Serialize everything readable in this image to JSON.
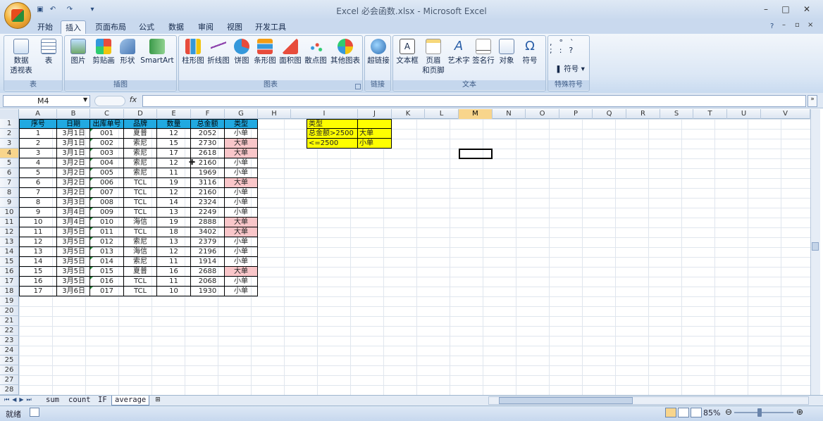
{
  "window": {
    "title": "Excel 必会函数.xlsx - Microsoft Excel"
  },
  "tabs": [
    "开始",
    "插入",
    "页面布局",
    "公式",
    "数据",
    "审阅",
    "视图",
    "开发工具"
  ],
  "active_tab": "插入",
  "ribbon": {
    "groups": [
      {
        "label": "表",
        "buttons": [
          "数据\n透视表",
          "表"
        ]
      },
      {
        "label": "插图",
        "buttons": [
          "图片",
          "剪贴画",
          "形状",
          "SmartArt"
        ]
      },
      {
        "label": "图表",
        "buttons": [
          "柱形图",
          "折线图",
          "饼图",
          "条形图",
          "面积图",
          "散点图",
          "其他图表"
        ]
      },
      {
        "label": "链接",
        "buttons": [
          "超链接"
        ]
      },
      {
        "label": "文本",
        "buttons": [
          "文本框",
          "页眉\n和页脚",
          "艺术字",
          "签名行",
          "对象",
          "符号"
        ]
      },
      {
        "label": "特殊符号",
        "buttons": [
          "符号"
        ]
      }
    ]
  },
  "formula_bar": {
    "name_box": "M4",
    "fx": "fx",
    "formula": ""
  },
  "columns": [
    "A",
    "B",
    "C",
    "D",
    "E",
    "F",
    "G",
    "H",
    "I",
    "J",
    "K",
    "L",
    "M",
    "N",
    "O",
    "P",
    "Q",
    "R",
    "S",
    "T",
    "U",
    "V"
  ],
  "selected_column": "M",
  "rows": [
    "1",
    "2",
    "3",
    "4",
    "5",
    "6",
    "7",
    "8",
    "9",
    "10",
    "11",
    "12",
    "13",
    "14",
    "15",
    "16",
    "17",
    "18",
    "19",
    "20",
    "21",
    "22",
    "23",
    "24",
    "25",
    "26",
    "27",
    "28"
  ],
  "selected_row": "4",
  "table": {
    "headers": [
      "序号",
      "日期",
      "出库单号",
      "品牌",
      "数量",
      "总金额",
      "类型"
    ],
    "rows": [
      [
        "1",
        "3月1日",
        "001",
        "夏普",
        "12",
        "2052",
        "小单"
      ],
      [
        "2",
        "3月1日",
        "002",
        "索尼",
        "15",
        "2730",
        "大单"
      ],
      [
        "3",
        "3月1日",
        "003",
        "索尼",
        "17",
        "2618",
        "大单"
      ],
      [
        "4",
        "3月2日",
        "004",
        "索尼",
        "12",
        "2160",
        "小单"
      ],
      [
        "5",
        "3月2日",
        "005",
        "索尼",
        "11",
        "1969",
        "小单"
      ],
      [
        "6",
        "3月2日",
        "006",
        "TCL",
        "19",
        "3116",
        "大单"
      ],
      [
        "7",
        "3月2日",
        "007",
        "TCL",
        "12",
        "2160",
        "小单"
      ],
      [
        "8",
        "3月3日",
        "008",
        "TCL",
        "14",
        "2324",
        "小单"
      ],
      [
        "9",
        "3月4日",
        "009",
        "TCL",
        "13",
        "2249",
        "小单"
      ],
      [
        "10",
        "3月4日",
        "010",
        "海信",
        "19",
        "2888",
        "大单"
      ],
      [
        "11",
        "3月5日",
        "011",
        "TCL",
        "18",
        "3402",
        "大单"
      ],
      [
        "12",
        "3月5日",
        "012",
        "索尼",
        "13",
        "2379",
        "小单"
      ],
      [
        "13",
        "3月5日",
        "013",
        "海信",
        "12",
        "2196",
        "小单"
      ],
      [
        "14",
        "3月5日",
        "014",
        "索尼",
        "11",
        "1914",
        "小单"
      ],
      [
        "15",
        "3月5日",
        "015",
        "夏普",
        "16",
        "2688",
        "大单"
      ],
      [
        "16",
        "3月5日",
        "016",
        "TCL",
        "11",
        "2068",
        "小单"
      ],
      [
        "17",
        "3月6日",
        "017",
        "TCL",
        "10",
        "1930",
        "小单"
      ]
    ]
  },
  "criteria": {
    "title": "类型",
    "rows": [
      [
        "总金额>2500",
        "大单"
      ],
      [
        "<=2500",
        "小单"
      ]
    ]
  },
  "sheets": [
    "sum",
    "count",
    "IF",
    "average"
  ],
  "active_sheet": "average",
  "status": {
    "text": "就绪",
    "zoom": "85%"
  },
  "colors": {
    "header": "#21a9e1",
    "highlight": "#f9c6c9",
    "criteria": "#ffff00"
  }
}
